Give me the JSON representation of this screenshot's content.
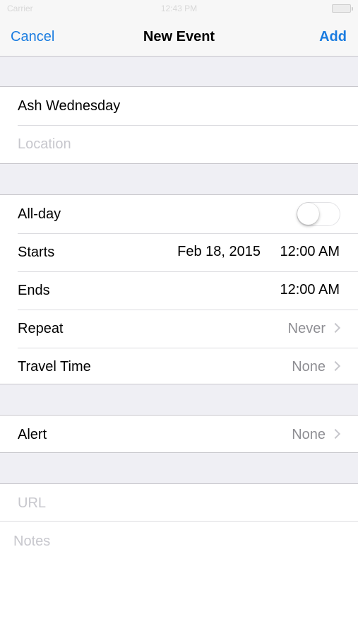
{
  "status_bar": {
    "carrier": "Carrier",
    "time": "12:43 PM"
  },
  "nav": {
    "cancel_label": "Cancel",
    "title": "New Event",
    "add_label": "Add"
  },
  "title_section": {
    "title_value": "Ash Wednesday",
    "location_placeholder": "Location"
  },
  "time_section": {
    "all_day_label": "All-day",
    "all_day_on": false,
    "starts_label": "Starts",
    "starts_date": "Feb 18, 2015",
    "starts_time": "12:00 AM",
    "ends_label": "Ends",
    "ends_time": "12:00 AM",
    "repeat_label": "Repeat",
    "repeat_value": "Never",
    "travel_label": "Travel Time",
    "travel_value": "None"
  },
  "alert_section": {
    "alert_label": "Alert",
    "alert_value": "None"
  },
  "extra_section": {
    "url_placeholder": "URL",
    "notes_placeholder": "Notes"
  },
  "colors": {
    "accent": "#1a7ce0",
    "group_background": "#efeff4",
    "separator": "#c8c7cc",
    "placeholder": "#c7c7cd",
    "detail_text": "#8e8e93"
  },
  "icons": [
    "battery-icon",
    "chevron-right-icon"
  ]
}
